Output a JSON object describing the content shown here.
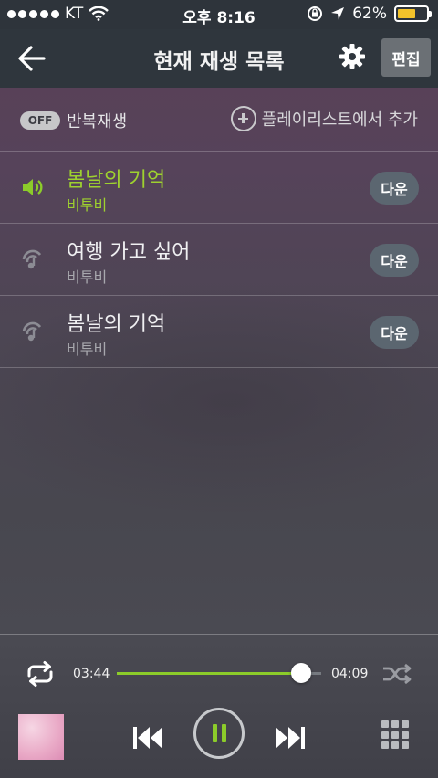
{
  "status_bar": {
    "carrier": "KT",
    "time": "오후 8:16",
    "battery": "62%",
    "battery_level": 0.62
  },
  "header": {
    "title": "현재 재생 목록",
    "edit_label": "편집",
    "icons": [
      "back-arrow-icon",
      "gear-icon"
    ]
  },
  "options": {
    "repeat_toggle": "OFF",
    "repeat_label": "반복재생",
    "add_label": "플레이리스트에서 추가"
  },
  "tracks": [
    {
      "title": "봄날의 기억",
      "artist": "비투비",
      "button": "다운",
      "playing": true
    },
    {
      "title": "여행 가고 싶어",
      "artist": "비투비",
      "button": "다운",
      "playing": false
    },
    {
      "title": "봄날의 기억",
      "artist": "비투비",
      "button": "다운",
      "playing": false
    }
  ],
  "player": {
    "current_time": "03:44",
    "total_time": "04:09",
    "progress": 0.9,
    "state": "playing"
  },
  "colors": {
    "accent": "#8ccc2a",
    "header_bg": "#2f363d"
  }
}
